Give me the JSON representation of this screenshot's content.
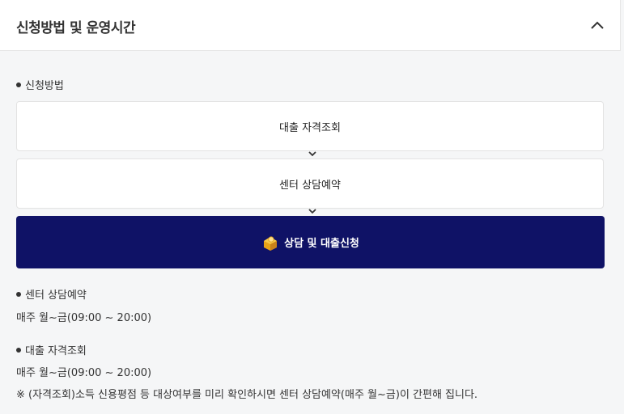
{
  "header": {
    "title": "신청방법 및 운영시간"
  },
  "icons": {
    "collapse": "chevron-up-icon",
    "cta": "consult-building-icon",
    "step_arrow": "chevron-down-icon"
  },
  "method": {
    "label": "신청방법",
    "steps": [
      "대출 자격조회",
      "센터 상담예약"
    ],
    "cta_label": "상담 및 대출신청"
  },
  "hours": [
    {
      "label": "센터 상담예약",
      "time": "매주 월~금(09:00 ~ 20:00)"
    },
    {
      "label": "대출 자격조회",
      "time": "매주 월~금(09:00 ~ 20:00)"
    }
  ],
  "note": "※ (자격조회)소득 신용평점 등 대상여부를 미리 확인하시면 센터 상담예약(매주 월~금)이 간편해 집니다.",
  "colors": {
    "cta_bg": "#0f1266",
    "page_bg": "#f5f6f7"
  }
}
